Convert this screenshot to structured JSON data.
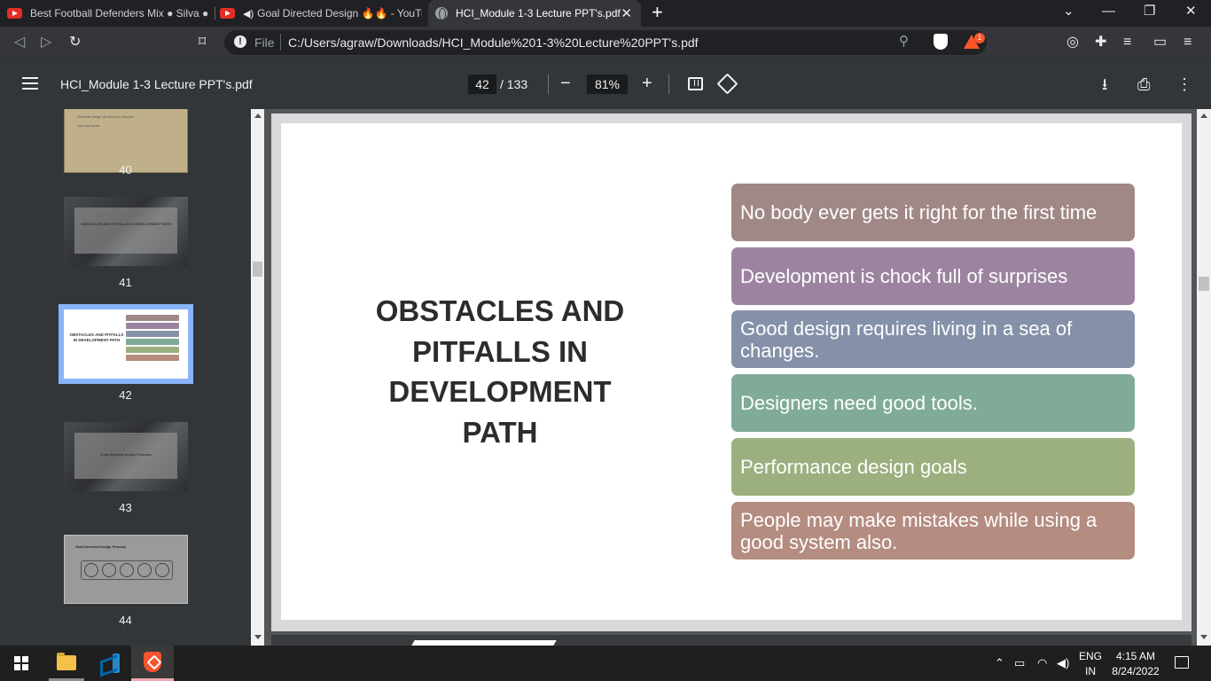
{
  "browser": {
    "tabs": [
      {
        "title": "Best Football Defenders Mix ● Silva ●",
        "icon": "youtube-icon"
      },
      {
        "title": "Goal Directed Design 🔥🔥 - YouTube",
        "icon": "youtube-icon"
      },
      {
        "title": "HCI_Module 1-3 Lecture PPT's.pdf",
        "icon": "globe-icon",
        "active": true
      }
    ],
    "new_tab": "+",
    "url_scheme_label": "File",
    "url": "C:/Users/agraw/Downloads/HCI_Module%201-3%20Lecture%20PPT's.pdf",
    "rewards_badge": "1",
    "window_controls": {
      "dropdown": "⌄",
      "minimize": "—",
      "restore": "❐",
      "close": "✕"
    }
  },
  "pdf_viewer": {
    "title": "HCI_Module 1-3 Lecture PPT's.pdf",
    "current_page": "42",
    "total_pages": "/ 133",
    "zoom": "81%",
    "zoom_out": "−",
    "zoom_in": "+"
  },
  "thumbnails": [
    {
      "page": "40",
      "lines": [
        "Deliberate design will drive your behavior",
        "Users and goals"
      ]
    },
    {
      "page": "41",
      "caption": "OBSTACLES AND PITFALLS IN DEVELOPMENT PATH"
    },
    {
      "page": "42",
      "caption": "OBSTACLES AND PITFALLS IN DEVELOPMENT PATH",
      "selected": true
    },
    {
      "page": "43",
      "caption": "Goal Directed Design Process"
    },
    {
      "page": "44",
      "caption": "Goal Directed Design Process"
    }
  ],
  "slide": {
    "title": "OBSTACLES AND PITFALLS IN DEVELOPMENT PATH",
    "items": [
      {
        "text": "No body ever gets it right for the first time",
        "color": "#a08886"
      },
      {
        "text": "Development is chock full of surprises",
        "color": "#9c84a0"
      },
      {
        "text": "Good design requires living in a sea of changes.",
        "color": "#8591a8"
      },
      {
        "text": "Designers need good tools.",
        "color": "#80ab98"
      },
      {
        "text": "Performance design goals",
        "color": "#9cb07f"
      },
      {
        "text": "People may make mistakes while using a good system also.",
        "color": "#b48c80"
      }
    ]
  },
  "taskbar": {
    "language": "ENG",
    "region": "IN",
    "time": "4:15 AM",
    "date": "8/24/2022"
  }
}
